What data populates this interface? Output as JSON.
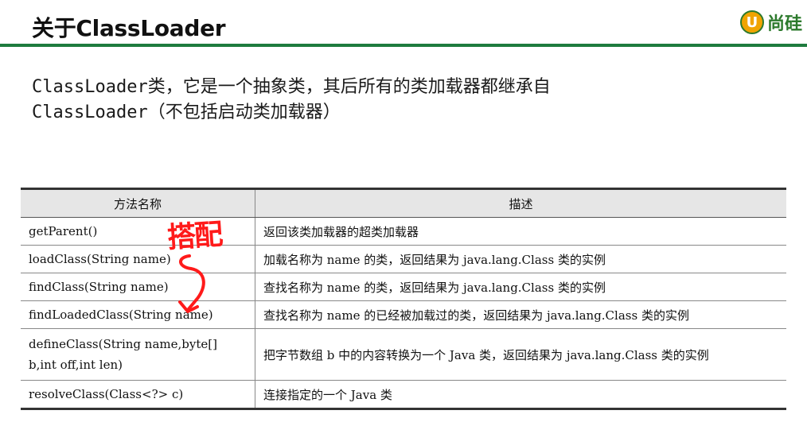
{
  "header": {
    "title": "关于ClassLoader",
    "logo_mark": "U",
    "logo_text": "尚硅"
  },
  "intro": {
    "line1": "ClassLoader类，它是一个抽象类，其后所有的类加载器都继承自",
    "line2": "ClassLoader（不包括启动类加载器）"
  },
  "table": {
    "headers": [
      "方法名称",
      "描述"
    ],
    "rows": [
      {
        "method": "getParent()",
        "desc": "返回该类加载器的超类加载器"
      },
      {
        "method": "loadClass(String name)",
        "desc": "加载名称为 name 的类，返回结果为 java.lang.Class 类的实例"
      },
      {
        "method": "findClass(String name)",
        "desc": "查找名称为 name 的类，返回结果为 java.lang.Class 类的实例"
      },
      {
        "method": "findLoadedClass(String name)",
        "desc": "查找名称为 name 的已经被加载过的类，返回结果为 java.lang.Class 类的实例"
      },
      {
        "method": "defineClass(String name,byte[] b,int off,int len)",
        "desc": "把字节数组 b 中的内容转换为一个 Java 类，返回结果为 java.lang.Class 类的实例"
      },
      {
        "method": "resolveClass(Class<?> c)",
        "desc": "连接指定的一个 Java 类"
      }
    ]
  },
  "annotation": {
    "text": "搭配",
    "color": "#ff1a1a"
  },
  "colors": {
    "header_rule": "#1e7b3e",
    "logo_orange": "#f0a400",
    "logo_green": "#2d7a2d",
    "table_header_bg": "#e6e6e6"
  }
}
